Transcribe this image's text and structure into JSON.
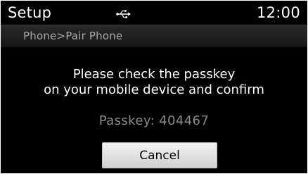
{
  "header": {
    "title": "Setup",
    "status_icon": "usb-icon",
    "clock": "12:00"
  },
  "breadcrumb": {
    "text": "Phone>Pair Phone"
  },
  "dialog": {
    "message_line1": "Please check the passkey",
    "message_line2": "on your mobile device and confirm",
    "passkey": "Passkey: 404467",
    "cancel_label": "Cancel"
  },
  "colors": {
    "background": "#000000",
    "text": "#ffffff",
    "breadcrumb_text": "#a9a9a9",
    "passkey_text": "#8c8c8c",
    "button_face": "#e2e2e2"
  }
}
